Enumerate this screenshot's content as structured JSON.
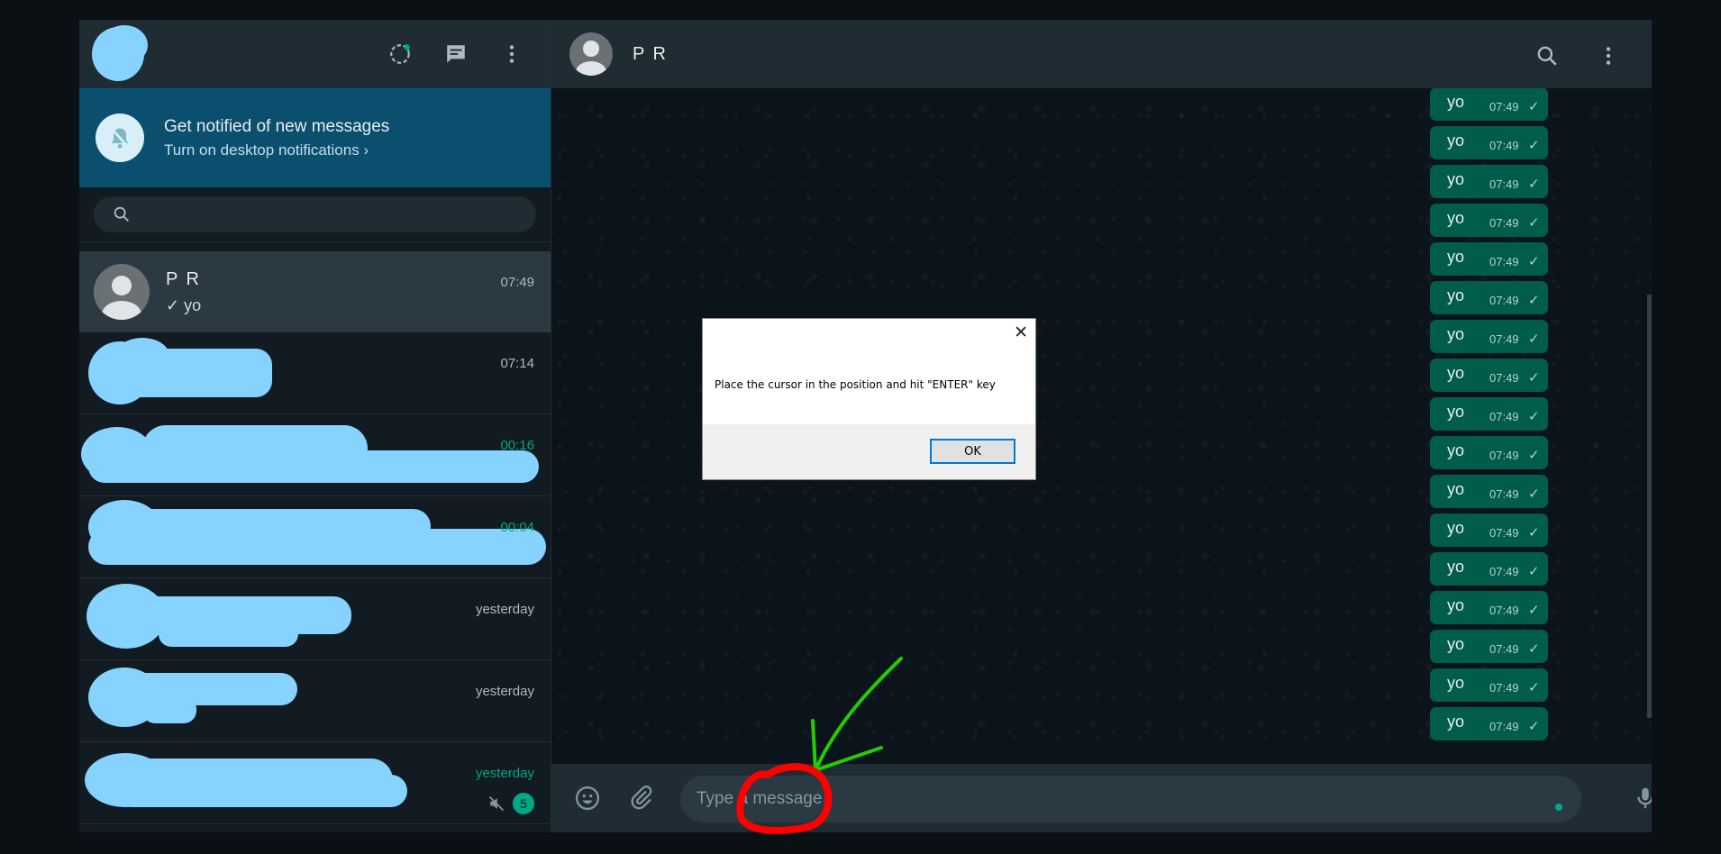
{
  "notification": {
    "title": "Get notified of new messages",
    "subtitle": "Turn on desktop notifications ›"
  },
  "search": {
    "placeholder": ""
  },
  "chats": [
    {
      "name": "P R",
      "preview": "✓ yo",
      "time": "07:49"
    },
    {
      "name": "",
      "preview": "",
      "time": "07:14"
    },
    {
      "name": "",
      "preview": "",
      "time": "00:16"
    },
    {
      "name": "",
      "preview": "",
      "time": "00:04"
    },
    {
      "name": "",
      "preview": "",
      "time": "yesterday"
    },
    {
      "name": "",
      "preview": "",
      "time": "yesterday"
    },
    {
      "name": "",
      "preview": "",
      "time": "yesterday",
      "unread": "5"
    }
  ],
  "conversation": {
    "contact_name": "P R",
    "messages": [
      {
        "text": "yo",
        "time": "07:49"
      },
      {
        "text": "yo",
        "time": "07:49"
      },
      {
        "text": "yo",
        "time": "07:49"
      },
      {
        "text": "yo",
        "time": "07:49"
      },
      {
        "text": "yo",
        "time": "07:49"
      },
      {
        "text": "yo",
        "time": "07:49"
      },
      {
        "text": "yo",
        "time": "07:49"
      },
      {
        "text": "yo",
        "time": "07:49"
      },
      {
        "text": "yo",
        "time": "07:49"
      },
      {
        "text": "yo",
        "time": "07:49"
      },
      {
        "text": "yo",
        "time": "07:49"
      },
      {
        "text": "yo",
        "time": "07:49"
      },
      {
        "text": "yo",
        "time": "07:49"
      },
      {
        "text": "yo",
        "time": "07:49"
      },
      {
        "text": "yo",
        "time": "07:49"
      },
      {
        "text": "yo",
        "time": "07:49"
      },
      {
        "text": "yo",
        "time": "07:49"
      }
    ],
    "input_placeholder": "Type a message"
  },
  "dialog": {
    "message": "Place the cursor in the position and hit \"ENTER\" key",
    "ok_label": "OK",
    "close_symbol": "✕"
  },
  "colors": {
    "accent": "#00a884",
    "bubble": "#005c4b",
    "panel": "#202c33",
    "notify_banner": "#0a4f6e",
    "redaction": "#86d3ff",
    "annotation_circle": "#ff0000",
    "annotation_arrow": "#22cc00"
  },
  "icons": {
    "status": "status-icon",
    "new_chat": "new-chat-icon",
    "menu": "kebab-menu-icon",
    "search": "search-icon",
    "emoji": "emoji-icon",
    "attach": "paperclip-icon",
    "mic": "microphone-icon",
    "bell_off": "bell-off-icon",
    "muted": "muted-speaker-icon"
  }
}
